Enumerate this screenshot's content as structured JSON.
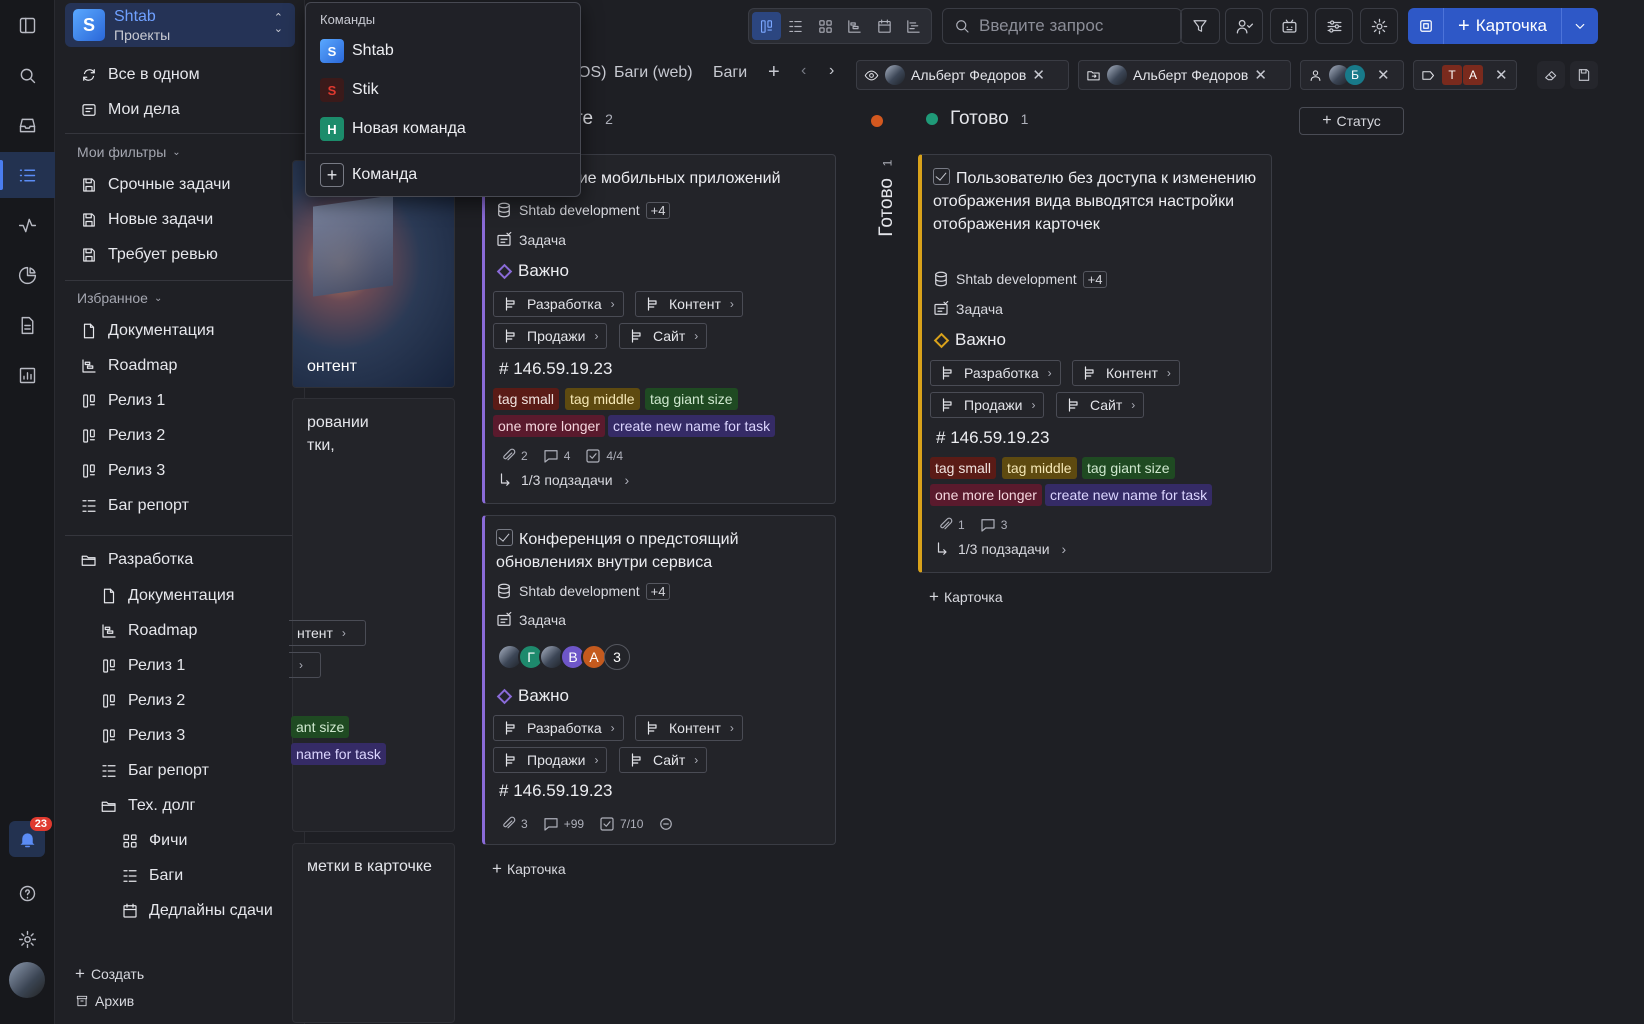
{
  "rail": {
    "notifications_count": "23",
    "icons": [
      "panel-icon",
      "search-icon",
      "inbox-icon",
      "list-icon",
      "activity-icon",
      "chart-icon",
      "document-icon",
      "report-icon",
      "bell-icon",
      "help-icon",
      "settings-icon"
    ]
  },
  "project": {
    "name": "Shtab",
    "subtitle": "Проекты"
  },
  "sidebar": {
    "top": [
      {
        "label": "Все в одном"
      },
      {
        "label": "Мои дела"
      }
    ],
    "filters_title": "Мои фильтры",
    "filters": [
      {
        "label": "Срочные задачи"
      },
      {
        "label": "Новые задачи"
      },
      {
        "label": "Требует ревью"
      }
    ],
    "favorites_title": "Избранное",
    "favorites": [
      {
        "label": "Документация"
      },
      {
        "label": "Roadmap"
      },
      {
        "label": "Релиз 1"
      },
      {
        "label": "Релиз 2"
      },
      {
        "label": "Релиз 3"
      },
      {
        "label": "Баг репорт"
      }
    ],
    "folder": "Разработка",
    "folder_items": [
      {
        "label": "Документация"
      },
      {
        "label": "Roadmap"
      },
      {
        "label": "Релиз 1"
      },
      {
        "label": "Релиз 2"
      },
      {
        "label": "Релиз 3"
      },
      {
        "label": "Баг репорт"
      }
    ],
    "subfolder": "Тех. долг",
    "subfolder_items": [
      {
        "label": "Фичи"
      },
      {
        "label": "Баги"
      },
      {
        "label": "Дедлайны сдачи"
      }
    ],
    "create": "Создать",
    "archive": "Архив"
  },
  "teams_menu": {
    "title": "Команды",
    "items": [
      {
        "label": "Shtab",
        "logo": "S"
      },
      {
        "label": "Stik",
        "logo": "S"
      },
      {
        "label": "Новая команда",
        "logo": "Н"
      }
    ],
    "add": "Команда"
  },
  "toolbar": {
    "search_placeholder": "Введите запрос",
    "card_button": "Карточка"
  },
  "tabs": {
    "partial1": "OS)",
    "tab2": "Баги (web)",
    "tab3": "Баги"
  },
  "filter_chips": {
    "watcher": "Альберт Федоров",
    "assignee": "Альберт Федоров",
    "users_avatar": "Б",
    "tags_avatars": [
      "Т",
      "А"
    ]
  },
  "columns": {
    "col1_partial": {
      "title_fragment": "те",
      "count": "2"
    },
    "done": {
      "title": "Готово",
      "count": "1",
      "vertical_title": "Готово",
      "vertical_count": "1",
      "color": "#1f9a78"
    },
    "add_status": "Статус"
  },
  "left_cards_partial": {
    "c1_text": "онтент",
    "c2_line1": "ровании",
    "c2_line2": "тки,",
    "c2_pill": "нтент",
    "c2_tag1": "ant size",
    "c2_tag2": "name for task",
    "c3_text": "метки в карточке"
  },
  "card1": {
    "title": "ение мобильных приложений",
    "project": "Shtab development",
    "project_more": "+4",
    "type": "Задача",
    "priority": "Важно",
    "pills": [
      "Разработка",
      "Контент",
      "Продажи",
      "Сайт"
    ],
    "number": "146.59.19.23",
    "tags": [
      "tag small",
      "tag middle",
      "tag giant size",
      "one more longer",
      "create new name for task"
    ],
    "attachments": "2",
    "comments": "4",
    "checklist": "4/4",
    "subtasks": "1/3 подзадачи"
  },
  "card2": {
    "title": "Конференция о предстоящий обновлениях внутри сервиса",
    "project": "Shtab development",
    "project_more": "+4",
    "type": "Задача",
    "avatars": [
      "Г",
      "В",
      "А"
    ],
    "avatars_more": "3",
    "priority": "Важно",
    "pills": [
      "Разработка",
      "Контент",
      "Продажи",
      "Сайт"
    ],
    "number": "146.59.19.23",
    "attachments": "3",
    "comments": "+99",
    "checklist": "7/10"
  },
  "card3": {
    "title": "Пользователю без доступа к изменению отображения вида выводятся настройки отображения карточек",
    "project": "Shtab development",
    "project_more": "+4",
    "type": "Задача",
    "priority": "Важно",
    "pills": [
      "Разработка",
      "Контент",
      "Продажи",
      "Сайт"
    ],
    "number": "146.59.19.23",
    "tags": [
      "tag small",
      "tag middle",
      "tag giant size",
      "one more longer",
      "create new name for task"
    ],
    "attachments": "1",
    "comments": "3",
    "subtasks": "1/3 подзадачи"
  },
  "add_card": "Карточка"
}
